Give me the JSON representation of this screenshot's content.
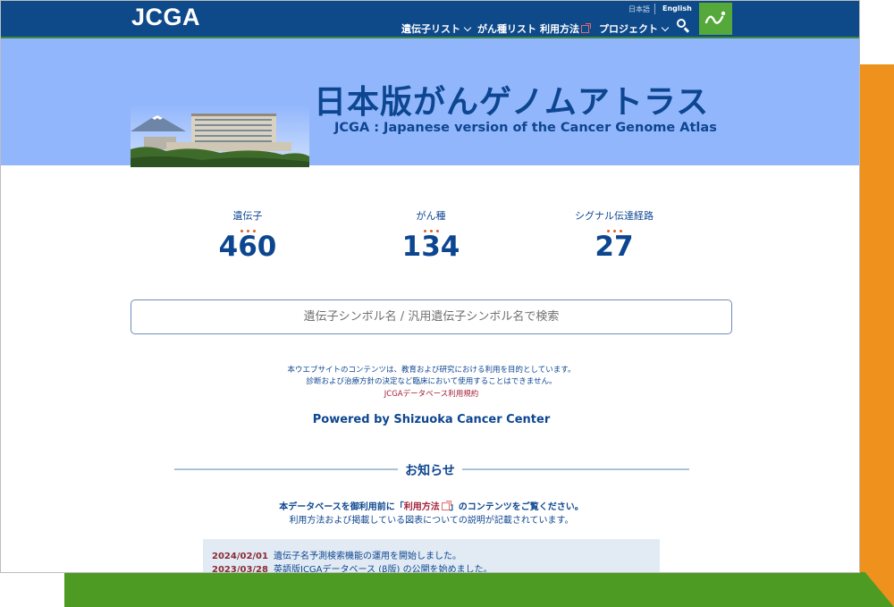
{
  "header": {
    "logo": "JCGA",
    "lang_ja": "日本語",
    "lang_en": "English",
    "nav": {
      "genes": "遺伝子リスト",
      "cancers": "がん種リスト",
      "usage": "利用方法",
      "project": "プロジェクト"
    }
  },
  "hero": {
    "title": "日本版がんゲノムアトラス",
    "subtitle": "JCGA : Japanese version of the Cancer Genome Atlas"
  },
  "stats": [
    {
      "label": "遺伝子",
      "value": "460"
    },
    {
      "label": "がん種",
      "value": "134"
    },
    {
      "label": "シグナル伝達経路",
      "value": "27"
    }
  ],
  "search": {
    "placeholder": "遺伝子シンボル名 / 汎用遺伝子シンボル名で検索"
  },
  "notes": {
    "line1": "本ウエブサイトのコンテンツは、教育および研究における利用を目的としています。",
    "line2": "診断および治療方針の決定など臨床において使用することはできません。",
    "terms_link": "JCGAデータベース利用規約",
    "powered": "Powered by Shizuoka Cancer Center"
  },
  "news": {
    "heading": "お知らせ",
    "intro_pre": "本データベースを御利用前に「",
    "intro_link": "利用方法",
    "intro_post": "」のコンテンツをご覧ください。",
    "intro2": "利用方法および掲載している図表についての説明が記載されています。",
    "items": [
      {
        "date": "2024/02/01",
        "text": "遺伝子名予測検索機能の運用を開始しました。"
      },
      {
        "date": "2023/03/28",
        "text": "英語版JCGAデータベース (β版) の公開を始めました。"
      }
    ]
  },
  "colors": {
    "header": "#0e4a8a",
    "hero": "#92b6fc",
    "accent_text": "#0d4690",
    "link_red": "#a3213a",
    "brand_green": "#55a83a",
    "deco_orange": "#ee911d",
    "deco_green": "#4e9b24"
  }
}
